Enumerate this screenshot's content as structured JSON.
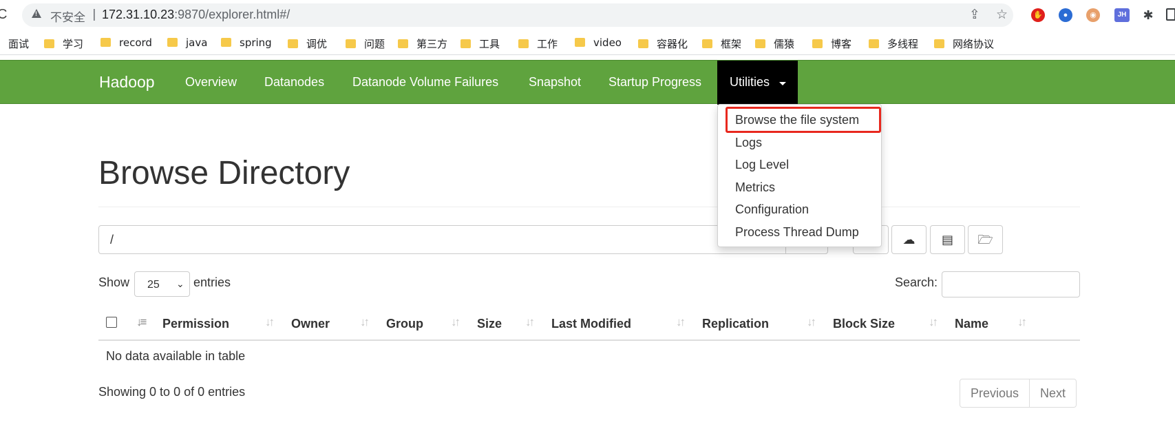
{
  "browser": {
    "security_label": "不安全",
    "url_host": "172.31.10.23",
    "url_rest": ":9870/explorer.html#/",
    "bookmarks": [
      {
        "label": "面试",
        "folder": false
      },
      {
        "label": "学习",
        "folder": true
      },
      {
        "label": "record",
        "folder": true
      },
      {
        "label": "java",
        "folder": true
      },
      {
        "label": "spring",
        "folder": true
      },
      {
        "label": "调优",
        "folder": true
      },
      {
        "label": "问题",
        "folder": true
      },
      {
        "label": "第三方",
        "folder": true
      },
      {
        "label": "工具",
        "folder": true
      },
      {
        "label": "工作",
        "folder": true
      },
      {
        "label": "video",
        "folder": true
      },
      {
        "label": "容器化",
        "folder": true
      },
      {
        "label": "框架",
        "folder": true
      },
      {
        "label": "儒猿",
        "folder": true
      },
      {
        "label": "博客",
        "folder": true
      },
      {
        "label": "多线程",
        "folder": true
      },
      {
        "label": "网络协议",
        "folder": true
      }
    ],
    "extension_4_label": "JH"
  },
  "navbar": {
    "brand": "Hadoop",
    "links": [
      "Overview",
      "Datanodes",
      "Datanode Volume Failures",
      "Snapshot",
      "Startup Progress"
    ],
    "active": "Utilities",
    "bg_color": "#5fa33e"
  },
  "dropdown": {
    "items": [
      "Browse the file system",
      "Logs",
      "Log Level",
      "Metrics",
      "Configuration",
      "Process Thread Dump"
    ],
    "highlight_color": "#e8281e"
  },
  "main": {
    "title": "Browse Directory",
    "path_value": "/",
    "show_label": "Show",
    "entries_selected": "25",
    "entries_label": "entries",
    "search_label": "Search:",
    "columns": [
      "Permission",
      "Owner",
      "Group",
      "Size",
      "Last Modified",
      "Replication",
      "Block Size",
      "Name"
    ],
    "empty_text": "No data available in table",
    "info_text": "Showing 0 to 0 of 0 entries",
    "pager": {
      "previous": "Previous",
      "next": "Next"
    }
  }
}
